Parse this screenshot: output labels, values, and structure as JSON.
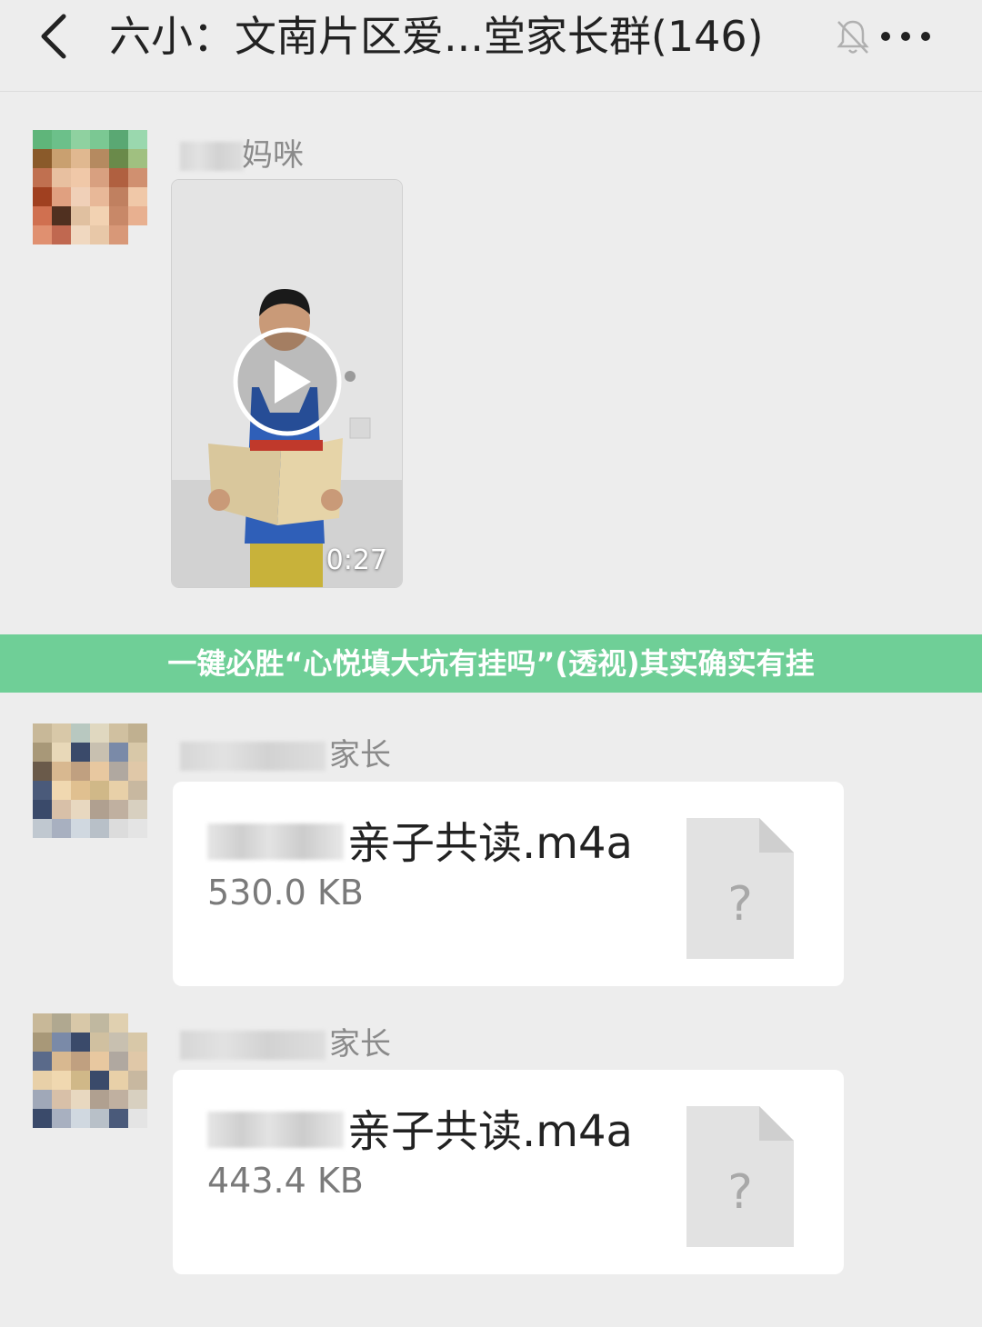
{
  "header": {
    "title": "六小：文南片区爱...堂家长群(146)"
  },
  "messages": [
    {
      "sender_visible": "妈咪",
      "type": "video",
      "duration": "0:27"
    },
    {
      "sender_visible": "家长",
      "type": "file",
      "file_name_visible": "亲子共读.m4a",
      "file_size": "530.0 KB"
    },
    {
      "sender_visible": "家长",
      "type": "file",
      "file_name_visible": "亲子共读.m4a",
      "file_size": "443.4 KB"
    }
  ],
  "banner": {
    "text": "一键必胜“心悦填大坑有挂吗”(透视)其实确实有挂"
  },
  "colors": {
    "background": "#ededed",
    "banner": "#6fcf97",
    "bubble": "#ffffff"
  },
  "icons": [
    "back-icon",
    "mute-icon",
    "more-icon",
    "play-icon",
    "unknown-file-icon"
  ]
}
